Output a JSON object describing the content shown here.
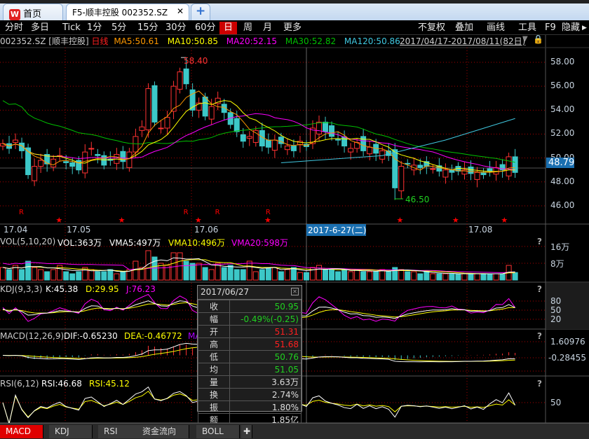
{
  "tabs": [
    {
      "label": "首页"
    },
    {
      "label": "F5-顺丰控股  002352.SZ"
    }
  ],
  "toolbar": {
    "periods": [
      "分时",
      "多日",
      "Tick",
      "1分",
      "5分",
      "15分",
      "30分",
      "60分",
      "日",
      "周",
      "月",
      "更多"
    ],
    "active": "日",
    "right": [
      "不复权",
      "叠加",
      "画线",
      "工具",
      "F9",
      "隐藏"
    ]
  },
  "info": {
    "code": "002352.SZ [顺丰控股]",
    "period": "日线",
    "ma5": "MA5:50.61",
    "ma10": "MA10:50.85",
    "ma20": "MA20:52.15",
    "ma30": "MA30:52.82",
    "ma120": "MA120:50.86",
    "range": "2017/04/17-2017/08/11(82日)"
  },
  "colors": {
    "up": "#ff3232",
    "down": "#3cc8c8",
    "ma5": "#ff9900",
    "ma10": "#ffff00",
    "ma20": "#ff00ff",
    "ma30": "#00c000",
    "ma120": "#40c8e0"
  },
  "price_axis": {
    "ticks": [
      "58.00",
      "56.00",
      "54.00",
      "52.00",
      "50.00",
      "48.00",
      "46.00"
    ],
    "current": "48.79"
  },
  "annotations": {
    "high": "58.40",
    "low": "46.50",
    "crosshair_date": "2017-6-27(二)"
  },
  "date_axis": [
    "17.04",
    "17.05",
    "17.06",
    "17.08"
  ],
  "vol": {
    "title": "VOL(5,10,20)",
    "vol": "VOL:363万",
    "vma5": "VMA5:497万",
    "vma10": "VMA10:496万",
    "vma20": "VMA20:598万",
    "ticks": [
      "16万",
      "8万"
    ]
  },
  "kdj": {
    "title": "KDJ(9,3,3)",
    "k": "K:45.38",
    "d": "D:29.95",
    "j": "J:76.23",
    "ticks": [
      "80",
      "50",
      "20"
    ]
  },
  "macd": {
    "title": "MACD(12,26,9)",
    "dif": "DIF:-0.65230",
    "dea": "DEA:-0.46772",
    "ma": "MA",
    "ticks": [
      "1.60976",
      "-0.28455"
    ]
  },
  "rsi": {
    "title": "RSI(6,12)",
    "rsi1": "RSI:46.68",
    "rsi2": "RSI:45.12",
    "ticks": [
      "50"
    ]
  },
  "help": "?",
  "popup": {
    "date": "2017/06/27",
    "rows": [
      {
        "k": "收",
        "v": "50.95",
        "c": "#20d020"
      },
      {
        "k": "幅",
        "v": "-0.49%(-0.25)",
        "c": "#20d020"
      },
      {
        "k": "开",
        "v": "51.31",
        "c": "#ff2020"
      },
      {
        "k": "高",
        "v": "51.68",
        "c": "#ff2020"
      },
      {
        "k": "低",
        "v": "50.76",
        "c": "#20d020"
      },
      {
        "k": "均",
        "v": "51.05",
        "c": "#20d020"
      },
      {
        "k": "量",
        "v": "3.63万",
        "c": "#ddd"
      },
      {
        "k": "换",
        "v": "2.74%",
        "c": "#ddd"
      },
      {
        "k": "振",
        "v": "1.80%",
        "c": "#ddd"
      },
      {
        "k": "额",
        "v": "1.85亿",
        "c": "#ddd"
      }
    ]
  },
  "bottom_tabs": [
    "MACD",
    "KDJ",
    "RSI",
    "资金流向",
    "BOLL"
  ],
  "chart_data": {
    "type": "candlestick",
    "days": 82,
    "close": [
      51.2,
      50.8,
      51.5,
      50.6,
      48.6,
      49.3,
      49.8,
      49.5,
      49.9,
      50.2,
      49.6,
      49.3,
      49.0,
      50.5,
      50.8,
      50.2,
      49.4,
      49.8,
      50.3,
      49.7,
      50.5,
      51.8,
      52.6,
      55.8,
      53.0,
      52.5,
      53.4,
      56.0,
      57.2,
      56.2,
      54.0,
      54.6,
      53.5,
      54.3,
      55.0,
      53.8,
      52.8,
      52.2,
      51.4,
      51.8,
      52.3,
      51.0,
      50.9,
      51.5,
      51.2,
      51.0,
      50.6,
      51.4,
      50.95,
      52.5,
      53.0,
      52.2,
      51.8,
      51.5,
      51.0,
      50.8,
      51.3,
      50.6,
      50.9,
      50.4,
      50.6,
      50.2,
      47.5,
      49.3,
      49.5,
      49.4,
      49.2,
      49.3,
      49.1,
      48.9,
      49.0,
      48.8,
      48.9,
      49.0,
      48.7,
      48.8,
      48.6,
      48.9,
      49.2,
      49.0,
      50.1,
      48.79
    ],
    "volume": [
      6,
      5,
      7,
      5,
      9,
      6,
      5,
      4,
      5,
      7,
      4,
      3,
      4,
      6,
      5,
      4,
      4,
      5,
      3,
      4,
      5,
      9,
      6,
      14,
      11,
      8,
      7,
      13,
      13,
      9,
      8,
      8,
      6,
      5,
      8,
      6,
      7,
      5,
      5,
      9,
      4,
      5,
      6,
      6,
      4,
      5,
      6,
      3.6,
      3.6,
      6,
      7,
      5,
      5,
      4,
      5,
      4,
      5,
      4,
      4,
      4,
      5,
      4,
      6,
      5,
      4,
      4,
      3,
      4,
      3,
      3,
      3,
      3,
      3,
      3,
      3,
      3,
      3,
      3,
      3,
      3,
      7,
      3.6
    ],
    "ma120": [
      [
        44,
        49.6
      ],
      [
        60,
        50.2
      ],
      [
        70,
        51.5
      ],
      [
        81,
        53.3
      ]
    ],
    "price_range": [
      45,
      59.5
    ]
  }
}
